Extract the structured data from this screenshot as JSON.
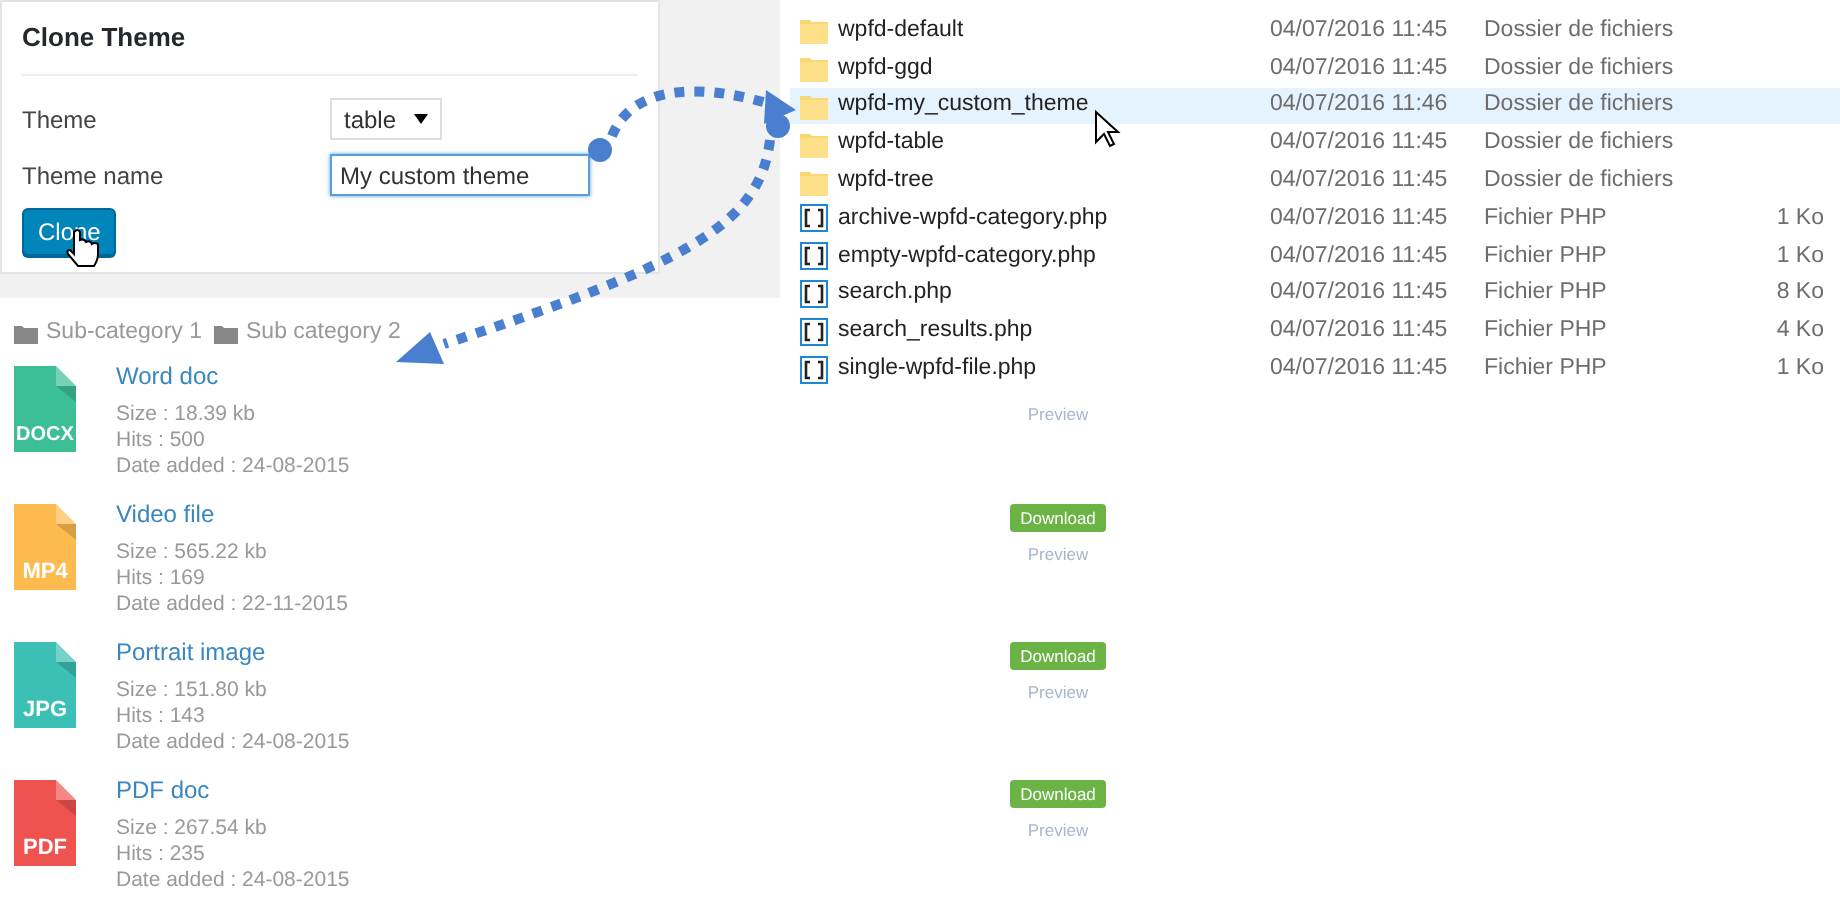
{
  "clone_panel": {
    "title": "Clone Theme",
    "theme": {
      "label": "Theme",
      "value": "table"
    },
    "theme_name": {
      "label": "Theme name",
      "value": "My custom theme"
    },
    "button": "Clone"
  },
  "explorer": {
    "rows": [
      {
        "kind": "folder",
        "name": "wpfd-default",
        "date": "04/07/2016 11:45",
        "type": "Dossier de fichiers",
        "selected": false
      },
      {
        "kind": "folder",
        "name": "wpfd-ggd",
        "date": "04/07/2016 11:45",
        "type": "Dossier de fichiers",
        "selected": false
      },
      {
        "kind": "folder",
        "name": "wpfd-my_custom_theme",
        "date": "04/07/2016 11:46",
        "type": "Dossier de fichiers",
        "selected": true
      },
      {
        "kind": "folder",
        "name": "wpfd-table",
        "date": "04/07/2016 11:45",
        "type": "Dossier de fichiers",
        "selected": false
      },
      {
        "kind": "folder",
        "name": "wpfd-tree",
        "date": "04/07/2016 11:45",
        "type": "Dossier de fichiers",
        "selected": false
      },
      {
        "kind": "php",
        "name": "archive-wpfd-category.php",
        "date": "04/07/2016 11:45",
        "type": "Fichier PHP",
        "size": "1 Ko",
        "selected": false
      },
      {
        "kind": "php",
        "name": "empty-wpfd-category.php",
        "date": "04/07/2016 11:45",
        "type": "Fichier PHP",
        "size": "1 Ko",
        "selected": false
      },
      {
        "kind": "php",
        "name": "search.php",
        "date": "04/07/2016 11:45",
        "type": "Fichier PHP",
        "size": "8 Ko",
        "selected": false
      },
      {
        "kind": "php",
        "name": "search_results.php",
        "date": "04/07/2016 11:45",
        "type": "Fichier PHP",
        "size": "4 Ko",
        "selected": false
      },
      {
        "kind": "php",
        "name": "single-wpfd-file.php",
        "date": "04/07/2016 11:45",
        "type": "Fichier PHP",
        "size": "1 Ko",
        "selected": false
      }
    ]
  },
  "categories": [
    "Sub-category 1",
    "Sub category 2"
  ],
  "files": [
    {
      "badge": "DOCX",
      "color": "#3dbf95",
      "title": "Word doc",
      "size": "Size : 18.39 kb",
      "hits": "Hits : 500",
      "date": "Date added : 24-08-2015",
      "preview": "Preview"
    },
    {
      "badge": "MP4",
      "color": "#fdbb4f",
      "title": "Video file",
      "size": "Size : 565.22 kb",
      "hits": "Hits : 169",
      "date": "Date added : 22-11-2015",
      "download": "Download",
      "preview": "Preview"
    },
    {
      "badge": "JPG",
      "color": "#3cc0b6",
      "title": "Portrait image",
      "size": "Size : 151.80 kb",
      "hits": "Hits : 143",
      "date": "Date added : 24-08-2015",
      "download": "Download",
      "preview": "Preview"
    },
    {
      "badge": "PDF",
      "color": "#ef5350",
      "title": "PDF doc",
      "size": "Size : 267.54 kb",
      "hits": "Hits : 235",
      "date": "Date added : 24-08-2015",
      "download": "Download",
      "preview": "Preview"
    }
  ]
}
